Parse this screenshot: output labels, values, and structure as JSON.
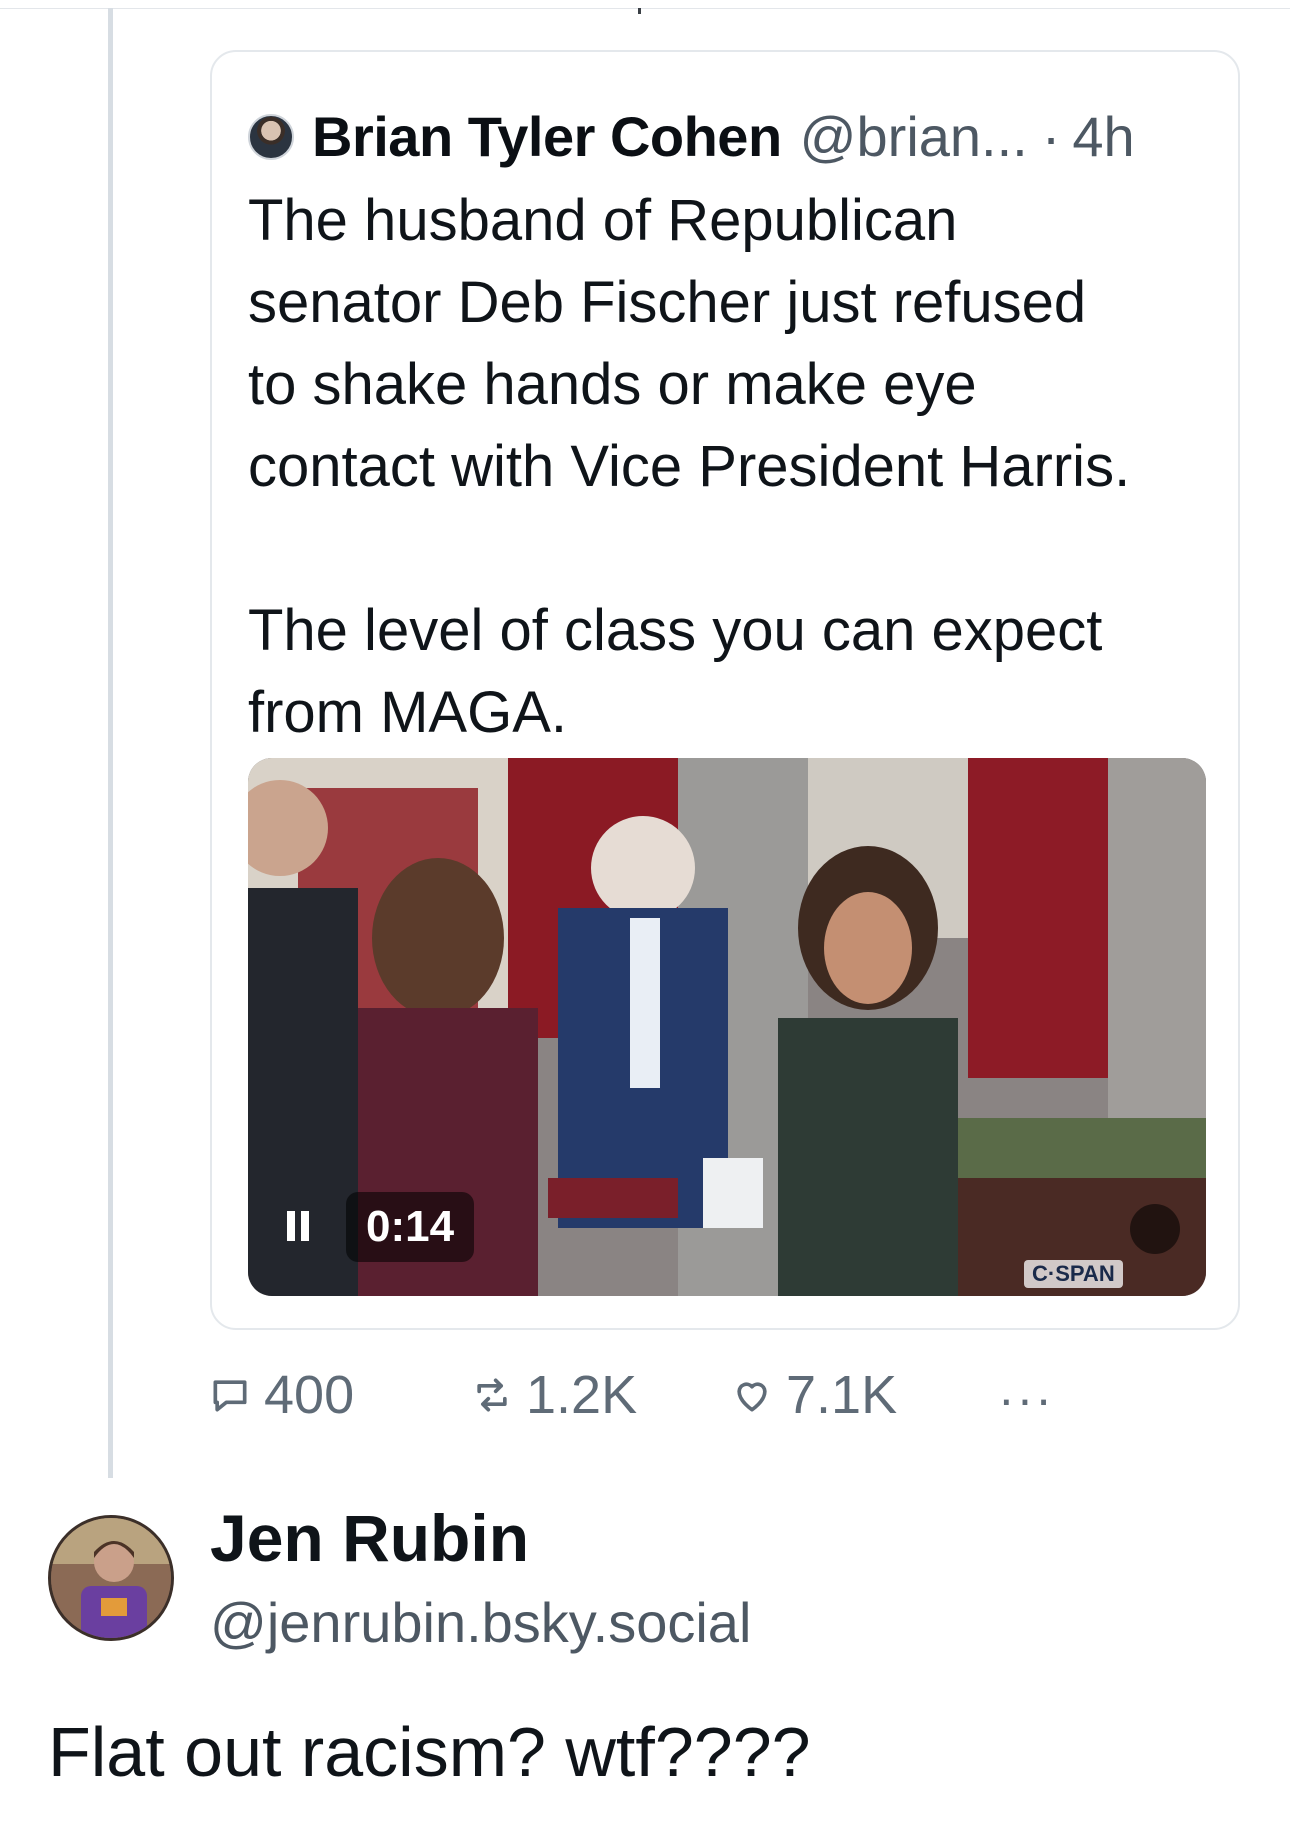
{
  "quoted_post": {
    "author_name": "Brian Tyler Cohen",
    "author_handle": "@brian...",
    "separator": "·",
    "time": "4h",
    "text": "The husband of Republican\nsenator Deb Fischer just refused\nto shake hands or make eye\ncontact with Vice President Harris.\n\nThe level of class you can expect\nfrom MAGA.",
    "video": {
      "timestamp": "0:14",
      "watermark": "C·SPAN",
      "state": "playing",
      "muted": true
    }
  },
  "actions": {
    "replies": "400",
    "reposts": "1.2K",
    "likes": "7.1K",
    "more": "···"
  },
  "post": {
    "author_name": "Jen Rubin",
    "author_handle": "@jenrubin.bsky.social",
    "text": "Flat out racism? wtf????"
  },
  "colors": {
    "text_primary": "#0f1419",
    "text_secondary": "#4d5863",
    "border": "#e4e8ec",
    "thread_line": "#d7dde3"
  },
  "icons": {
    "reply": "speech-bubble-icon",
    "repost": "repost-arrows-icon",
    "like": "heart-outline-icon",
    "more": "ellipsis-icon",
    "pause": "pause-icon",
    "mute": "speaker-muted-icon"
  }
}
